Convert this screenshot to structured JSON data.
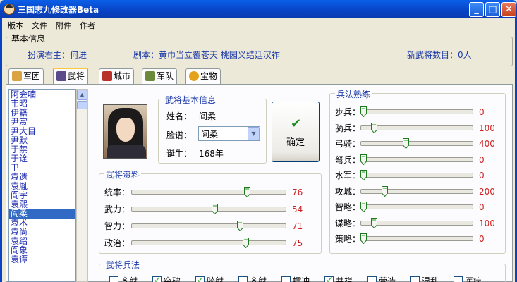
{
  "window": {
    "title": "三国志九修改器Beta",
    "min": "_",
    "max": "□",
    "close": "✕"
  },
  "menu": [
    "版本",
    "文件",
    "附件",
    "作者"
  ],
  "info": {
    "legend": "基本信息",
    "player": "扮演君主：何进",
    "scenario": "剧本：黄巾当立覆苍天 桃园义结廷汉祚",
    "new_count": "新武将数目：0人"
  },
  "tabs": [
    {
      "label": "军团",
      "icon": "army-icon",
      "active": false
    },
    {
      "label": "武将",
      "icon": "general-icon",
      "active": true
    },
    {
      "label": "城市",
      "icon": "city-icon",
      "active": false
    },
    {
      "label": "军队",
      "icon": "troops-icon",
      "active": false
    },
    {
      "label": "宝物",
      "icon": "treasure-icon",
      "active": false
    }
  ],
  "officer_list": {
    "items": [
      "阿会喃",
      "韦昭",
      "伊籍",
      "尹赏",
      "尹大目",
      "尹默",
      "于禁",
      "于诠",
      "卫",
      "袁遗",
      "袁胤",
      "阎宇",
      "袁熙",
      "阎柔",
      "袁术",
      "袁尚",
      "袁绍",
      "阎象",
      "袁谭"
    ],
    "selected": "阎柔"
  },
  "basic": {
    "legend": "武将基本信息",
    "name_label": "姓名：",
    "name_value": "阎柔",
    "face_label": "脸谱：",
    "face_value": "阎柔",
    "birth_label": "诞生：",
    "birth_value": "168年"
  },
  "confirm_label": "确定",
  "stats": {
    "legend": "武将资料",
    "max": 100,
    "items": [
      {
        "label": "统率：",
        "value": 76
      },
      {
        "label": "武力：",
        "value": 54
      },
      {
        "label": "智力：",
        "value": 71
      },
      {
        "label": "政治：",
        "value": 75
      }
    ]
  },
  "troops": {
    "legend": "兵法熟练",
    "max": 1000,
    "items": [
      {
        "label": "步兵：",
        "value": 0
      },
      {
        "label": "骑兵：",
        "value": 100
      },
      {
        "label": "弓骑：",
        "value": 400
      },
      {
        "label": "弩兵：",
        "value": 0
      },
      {
        "label": "水军：",
        "value": 0
      },
      {
        "label": "攻城：",
        "value": 200
      },
      {
        "label": "智略：",
        "value": 0
      },
      {
        "label": "谋略：",
        "value": 100
      },
      {
        "label": "策略：",
        "value": 0
      }
    ]
  },
  "tactics": {
    "legend": "武将兵法",
    "items": [
      {
        "label": "齐射",
        "checked": false
      },
      {
        "label": "突破",
        "checked": true
      },
      {
        "label": "骑射",
        "checked": true
      },
      {
        "label": "齐射",
        "checked": false
      },
      {
        "label": "蠕冲",
        "checked": false
      },
      {
        "label": "井栏",
        "checked": true
      },
      {
        "label": "营造",
        "checked": false
      },
      {
        "label": "混乱",
        "checked": false
      },
      {
        "label": "医疗",
        "checked": false
      }
    ]
  }
}
